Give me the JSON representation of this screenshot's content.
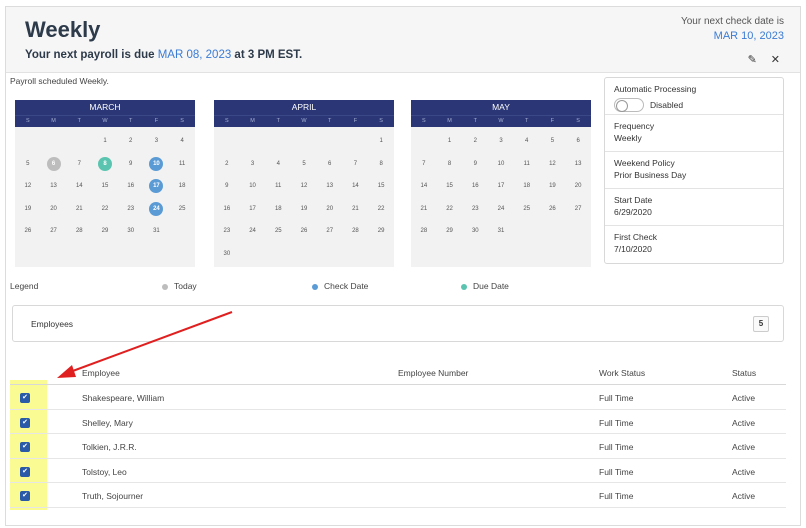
{
  "header": {
    "title": "Weekly",
    "subtitle_prefix": "Your next payroll is due ",
    "due_date": "MAR 08, 2023",
    "subtitle_suffix": " at 3 PM EST.",
    "next_check_label": "Your next check date is",
    "next_check_date": "MAR 10, 2023"
  },
  "schedule_text": "Payroll scheduled Weekly.",
  "calendars": [
    {
      "month": "MARCH",
      "dow": [
        "S",
        "M",
        "T",
        "W",
        "T",
        "F",
        "S"
      ],
      "offset": 3,
      "days": 31,
      "today": [
        6
      ],
      "check": [
        10,
        17,
        24
      ],
      "due": [
        8
      ]
    },
    {
      "month": "APRIL",
      "dow": [
        "S",
        "M",
        "T",
        "W",
        "T",
        "F",
        "S"
      ],
      "offset": 6,
      "days": 30,
      "today": [],
      "check": [],
      "due": []
    },
    {
      "month": "MAY",
      "dow": [
        "S",
        "M",
        "T",
        "W",
        "T",
        "F",
        "S"
      ],
      "offset": 1,
      "days": 31,
      "today": [],
      "check": [],
      "due": []
    }
  ],
  "info": {
    "auto_label": "Automatic Processing",
    "auto_state": "Disabled",
    "frequency_label": "Frequency",
    "frequency_value": "Weekly",
    "weekend_label": "Weekend Policy",
    "weekend_value": "Prior Business Day",
    "start_label": "Start Date",
    "start_value": "6/29/2020",
    "first_check_label": "First Check",
    "first_check_value": "7/10/2020"
  },
  "legend": {
    "label": "Legend",
    "today": "Today",
    "check": "Check Date",
    "due": "Due Date",
    "colors": {
      "today": "#bdbdbd",
      "check": "#5b9bd5",
      "due": "#5ac4b0"
    }
  },
  "employees": {
    "label": "Employees",
    "count": "5",
    "columns": {
      "employee": "Employee",
      "number": "Employee Number",
      "work_status": "Work Status",
      "status": "Status"
    },
    "rows": [
      {
        "name": "Shakespeare, William",
        "number": "",
        "work_status": "Full Time",
        "status": "Active"
      },
      {
        "name": "Shelley, Mary",
        "number": "",
        "work_status": "Full Time",
        "status": "Active"
      },
      {
        "name": "Tolkien, J.R.R.",
        "number": "",
        "work_status": "Full Time",
        "status": "Active"
      },
      {
        "name": "Tolstoy, Leo",
        "number": "",
        "work_status": "Full Time",
        "status": "Active"
      },
      {
        "name": "Truth, Sojourner",
        "number": "",
        "work_status": "Full Time",
        "status": "Active"
      }
    ]
  },
  "icons": {
    "edit": "pencil-icon",
    "close": "close-icon",
    "checkbox": "check-icon"
  }
}
